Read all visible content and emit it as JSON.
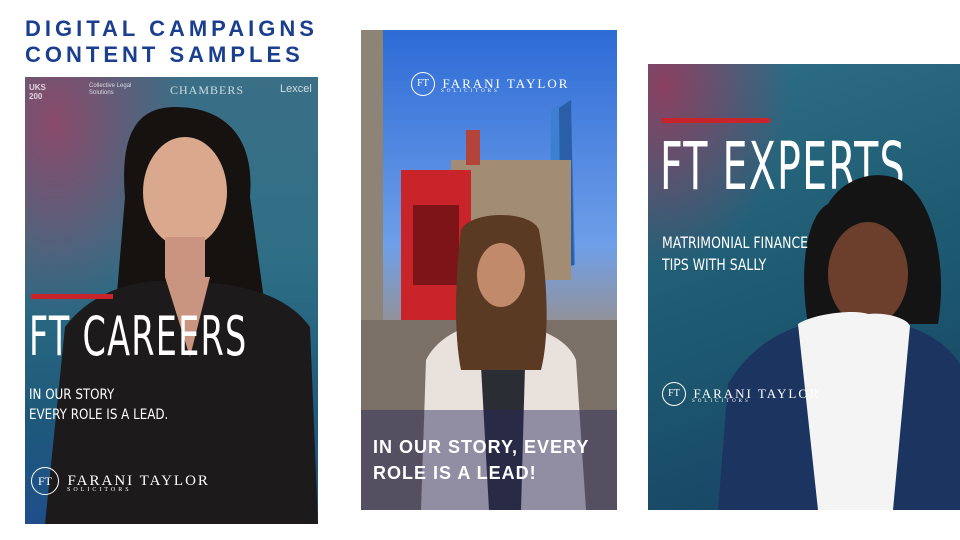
{
  "header": {
    "title_line1": "DIGITAL CAMPAIGNS",
    "title_line2": "CONTENT SAMPLES"
  },
  "colors": {
    "title": "#1b3f8f",
    "accent_red": "#c8242b"
  },
  "card1": {
    "logos": [
      "UKS 200",
      "Collective Legal Solutions",
      "CHAMBERS",
      "Lexcel"
    ],
    "headline": "FT CAREERS",
    "sub_line1": "IN OUR STORY",
    "sub_line2": "EVERY ROLE IS A LEAD.",
    "brand_monogram": "FT",
    "brand_name": "FARANI TAYLOR",
    "brand_tag": "SOLICITORS"
  },
  "card2": {
    "brand_monogram": "FT",
    "brand_name": "FARANI TAYLOR",
    "brand_tag": "SOLICITORS",
    "caption_line1": "IN OUR STORY, EVERY",
    "caption_line2": "ROLE IS A LEAD!"
  },
  "card3": {
    "headline": "FT EXPERTS",
    "sub_line1": "MATRIMONIAL FINANCE",
    "sub_line2": "TIPS WITH SALLY",
    "brand_monogram": "FT",
    "brand_name": "FARANI TAYLOR",
    "brand_tag": "SOLICITORS"
  }
}
